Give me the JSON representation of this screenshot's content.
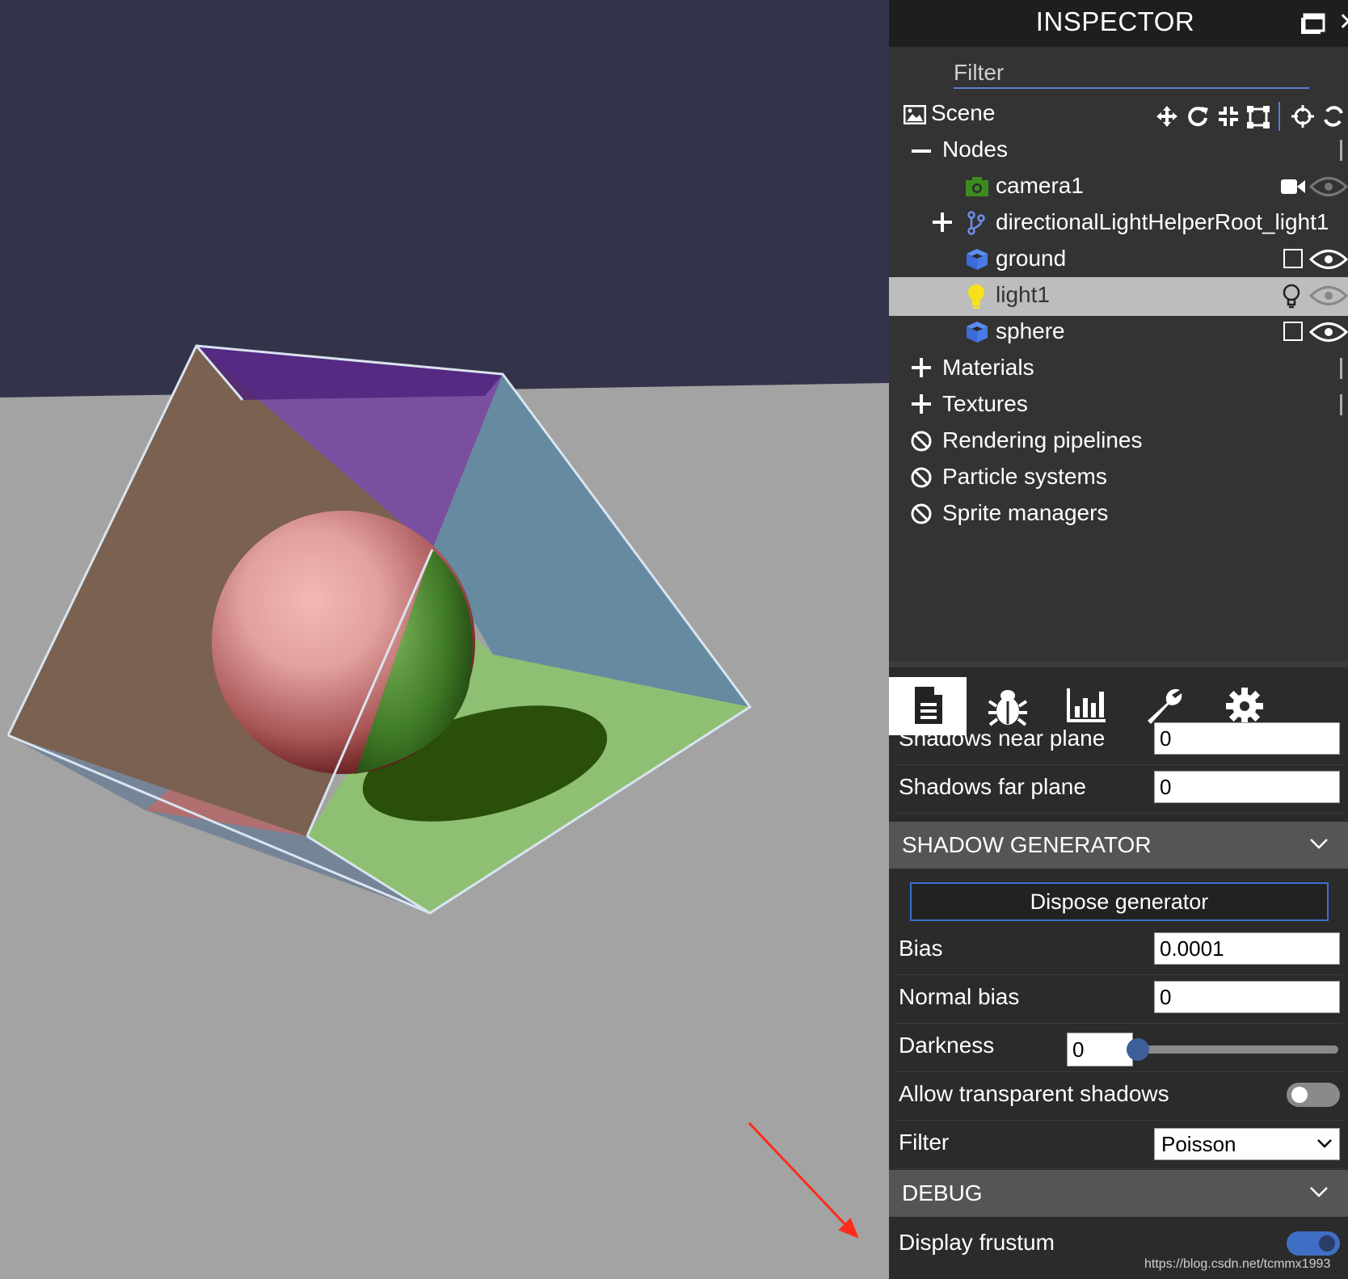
{
  "inspector": {
    "title": "INSPECTOR",
    "filter_placeholder": "Filter"
  },
  "scene_tree": {
    "scene_label": "Scene",
    "nodes_label": "Nodes",
    "nodes": [
      {
        "label": "camera1",
        "icon": "camera-icon"
      },
      {
        "label": "directionalLightHelperRoot_light1",
        "icon": "transform-node-icon"
      },
      {
        "label": "ground",
        "icon": "mesh-icon"
      },
      {
        "label": "light1",
        "icon": "lightbulb-icon",
        "selected": true
      },
      {
        "label": "sphere",
        "icon": "mesh-icon"
      }
    ],
    "sections": [
      {
        "label": "Materials",
        "icon": "expand-plus-icon"
      },
      {
        "label": "Textures",
        "icon": "expand-plus-icon"
      },
      {
        "label": "Rendering pipelines",
        "icon": "ban-icon"
      },
      {
        "label": "Particle systems",
        "icon": "ban-icon"
      },
      {
        "label": "Sprite managers",
        "icon": "ban-icon"
      }
    ]
  },
  "tabs": [
    {
      "name": "properties",
      "icon": "document-icon",
      "active": true
    },
    {
      "name": "debug",
      "icon": "bug-icon"
    },
    {
      "name": "statistics",
      "icon": "chart-icon"
    },
    {
      "name": "tools",
      "icon": "wrench-icon"
    },
    {
      "name": "settings",
      "icon": "gear-icon"
    }
  ],
  "properties": {
    "shadows_near_plane_label": "Shadows near plane",
    "shadows_near_plane_value": "0",
    "shadows_far_plane_label": "Shadows far plane",
    "shadows_far_plane_value": "0",
    "shadow_generator_title": "SHADOW GENERATOR",
    "dispose_label": "Dispose generator",
    "bias_label": "Bias",
    "bias_value": "0.0001",
    "normal_bias_label": "Normal bias",
    "normal_bias_value": "0",
    "darkness_label": "Darkness",
    "darkness_value": "0",
    "darkness_slider_fraction": 0,
    "allow_transparent_label": "Allow transparent shadows",
    "allow_transparent_on": false,
    "filter_label": "Filter",
    "filter_value": "Poisson",
    "debug_title": "DEBUG",
    "display_frustum_label": "Display frustum",
    "display_frustum_on": true
  },
  "watermark": "https://blog.csdn.net/tcmmx1993",
  "colors": {
    "sky": "#33334a",
    "ground": "#a3a3a3",
    "accent": "#3f6fc4",
    "arrow": "#ff2a1a"
  }
}
